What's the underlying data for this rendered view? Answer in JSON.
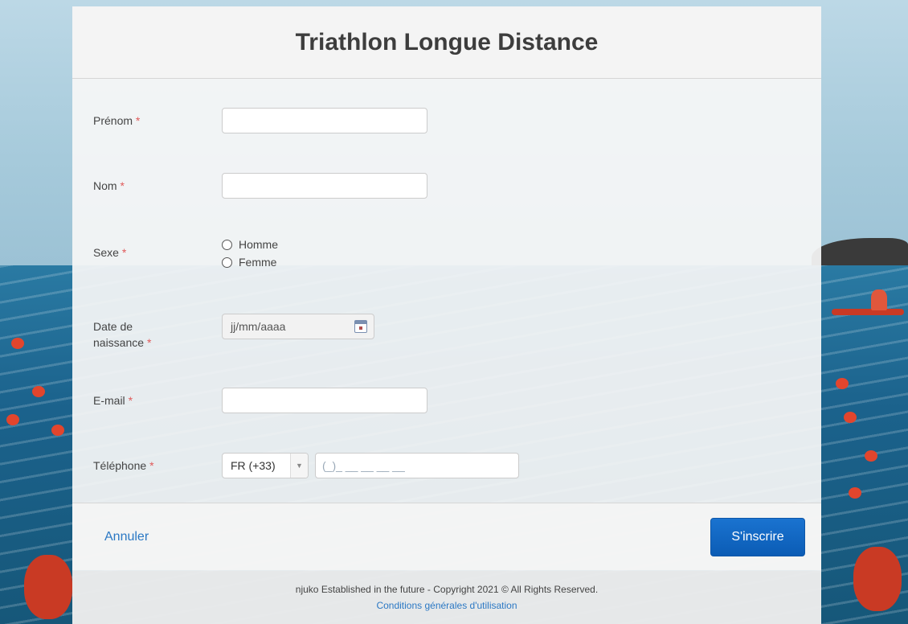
{
  "page": {
    "title": "Triathlon Longue Distance"
  },
  "form": {
    "required_mark": "*",
    "firstname": {
      "label": "Prénom",
      "value": ""
    },
    "lastname": {
      "label": "Nom",
      "value": ""
    },
    "sex": {
      "label": "Sexe",
      "options": [
        "Homme",
        "Femme"
      ]
    },
    "birthdate": {
      "label_line1": "Date de",
      "label_line2": "naissance",
      "placeholder": "jj/mm/aaaa"
    },
    "email": {
      "label": "E-mail",
      "value": ""
    },
    "phone": {
      "label": "Téléphone",
      "country": "FR (+33)",
      "placeholder": "(_)_ __ __ __ __"
    }
  },
  "actions": {
    "cancel_label": "Annuler",
    "submit_label": "S'inscrire"
  },
  "footer": {
    "copyright": "njuko Established in the future - Copyright 2021 © All Rights Reserved.",
    "terms_link": "Conditions générales d'utilisation"
  }
}
